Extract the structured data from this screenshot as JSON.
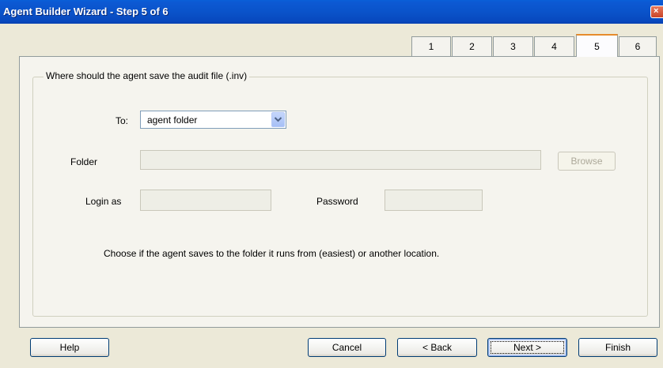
{
  "window": {
    "title": "Agent Builder Wizard - Step 5 of 6",
    "close_glyph": "×"
  },
  "tabs": [
    {
      "label": "1"
    },
    {
      "label": "2"
    },
    {
      "label": "3"
    },
    {
      "label": "4"
    },
    {
      "label": "5",
      "active": true
    },
    {
      "label": "6"
    }
  ],
  "group": {
    "title": "Where should the agent save the audit file (.inv)",
    "to_label": "To:",
    "to_value": "agent folder",
    "folder_label": "Folder",
    "folder_value": "",
    "browse_label": "Browse",
    "login_label": "Login as",
    "login_value": "",
    "password_label": "Password",
    "password_value": "",
    "hint": "Choose if the agent saves to the folder it runs from (easiest) or another location."
  },
  "footer": {
    "help": "Help",
    "cancel": "Cancel",
    "back": "< Back",
    "next": "Next >",
    "finish": "Finish"
  },
  "colors": {
    "titlebar": "#0A53CA",
    "dialog_bg": "#ECE9D8",
    "active_tab_accent": "#E68B2C"
  }
}
